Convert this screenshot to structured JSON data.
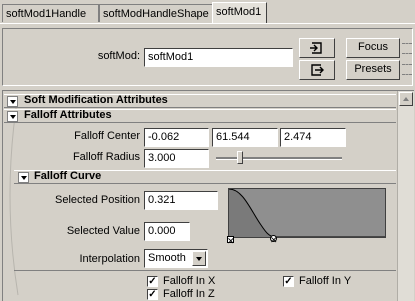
{
  "tabs": [
    "softMod1Handle",
    "softModHandleShape",
    "softMod1"
  ],
  "node": {
    "label": "softMod:",
    "value": "softMod1",
    "focus_label": "Focus",
    "presets_label": "Presets"
  },
  "sections": {
    "main_title": "Soft Modification Attributes",
    "falloff_attrs_title": "Falloff Attributes",
    "falloff_curve_title": "Falloff Curve"
  },
  "falloff": {
    "center_label": "Falloff Center",
    "center_x": "-0.062",
    "center_y": "61.544",
    "center_z": "2.474",
    "radius_label": "Falloff Radius",
    "radius_value": "3.000",
    "radius_slider_fraction": 0.17
  },
  "curve": {
    "selected_position_label": "Selected Position",
    "selected_position_value": "0.321",
    "selected_value_label": "Selected Value",
    "selected_value_value": "0.000",
    "interpolation_label": "Interpolation",
    "interpolation_value": "Smooth"
  },
  "checkboxes": [
    {
      "label": "Falloff In X",
      "checked": true
    },
    {
      "label": "Falloff In Y",
      "checked": true
    },
    {
      "label": "Falloff In Z",
      "checked": true
    }
  ]
}
